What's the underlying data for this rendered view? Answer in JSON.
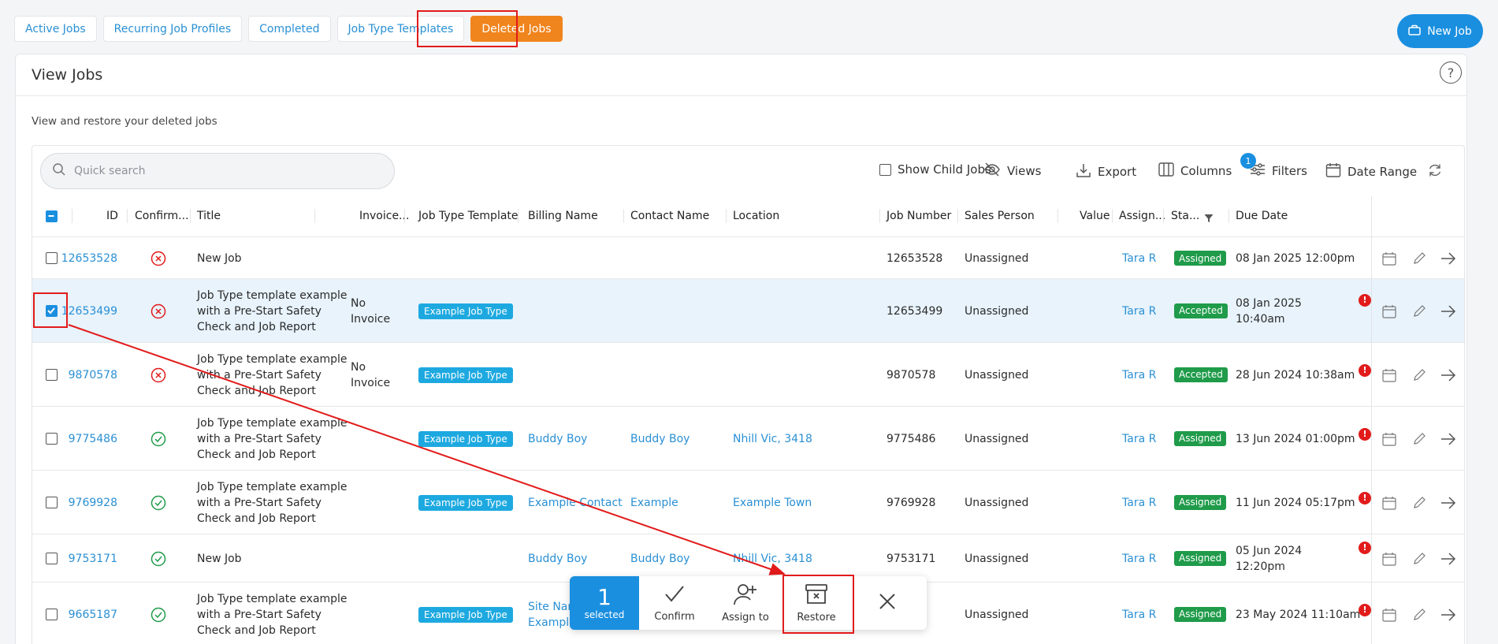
{
  "tabs": [
    {
      "label": "Active Jobs"
    },
    {
      "label": "Recurring Job Profiles"
    },
    {
      "label": "Completed"
    },
    {
      "label": "Job Type Templates"
    },
    {
      "label": "Deleted Jobs",
      "active": true
    }
  ],
  "new_job_label": "New Job",
  "page_title": "View Jobs",
  "help": "?",
  "subtitle": "View and restore your deleted jobs",
  "search": {
    "placeholder": "Quick search"
  },
  "toolbar": {
    "show_child_jobs": "Show Child Jobs",
    "views": "Views",
    "export": "Export",
    "columns": "Columns",
    "filters": "Filters",
    "filters_count": "1",
    "date_range": "Date Range"
  },
  "columns": [
    "ID",
    "Confirm...",
    "Title",
    "Invoice...",
    "Job Type Template",
    "Billing Name",
    "Contact Name",
    "Location",
    "Job Number",
    "Sales Person",
    "Value",
    "Assign...",
    "Sta...",
    "Due Date"
  ],
  "rows": [
    {
      "id": "12653528",
      "confirmed": false,
      "title": [
        "New Job"
      ],
      "invoice": [],
      "job_type": "",
      "billing": [],
      "contact": "",
      "location": "",
      "job_number": "12653528",
      "sales": "Unassigned",
      "value": "",
      "assigned": "Tara R",
      "status": "Assigned",
      "due": [
        "08 Jan 2025 12:00pm"
      ],
      "warn": false,
      "selected": false
    },
    {
      "id": "12653499",
      "confirmed": false,
      "title": [
        "Job Type template example",
        "with a Pre-Start Safety",
        "Check and Job Report"
      ],
      "invoice": [
        "No",
        "Invoice"
      ],
      "job_type": "Example Job Type",
      "billing": [],
      "contact": "",
      "location": "",
      "job_number": "12653499",
      "sales": "Unassigned",
      "value": "",
      "assigned": "Tara R",
      "status": "Accepted",
      "due": [
        "08 Jan 2025",
        "10:40am"
      ],
      "warn": true,
      "selected": true
    },
    {
      "id": "9870578",
      "confirmed": false,
      "title": [
        "Job Type template example",
        "with a Pre-Start Safety",
        "Check and Job Report"
      ],
      "invoice": [
        "No",
        "Invoice"
      ],
      "job_type": "Example Job Type",
      "billing": [],
      "contact": "",
      "location": "",
      "job_number": "9870578",
      "sales": "Unassigned",
      "value": "",
      "assigned": "Tara R",
      "status": "Accepted",
      "due": [
        "28 Jun 2024 10:38am"
      ],
      "warn": true,
      "selected": false
    },
    {
      "id": "9775486",
      "confirmed": true,
      "title": [
        "Job Type template example",
        "with a Pre-Start Safety",
        "Check and Job Report"
      ],
      "invoice": [],
      "job_type": "Example Job Type",
      "billing": [
        "Buddy Boy"
      ],
      "contact": "Buddy Boy",
      "location": "Nhill Vic, 3418",
      "job_number": "9775486",
      "sales": "Unassigned",
      "value": "",
      "assigned": "Tara R",
      "status": "Assigned",
      "due": [
        "13 Jun 2024 01:00pm"
      ],
      "warn": true,
      "selected": false
    },
    {
      "id": "9769928",
      "confirmed": true,
      "title": [
        "Job Type template example",
        "with a Pre-Start Safety",
        "Check and Job Report"
      ],
      "invoice": [],
      "job_type": "Example Job Type",
      "billing": [
        "Example Contact"
      ],
      "contact": "Example",
      "location": "Example Town",
      "job_number": "9769928",
      "sales": "Unassigned",
      "value": "",
      "assigned": "Tara R",
      "status": "Assigned",
      "due": [
        "11 Jun 2024 05:17pm"
      ],
      "warn": true,
      "selected": false
    },
    {
      "id": "9753171",
      "confirmed": true,
      "title": [
        "New Job"
      ],
      "invoice": [],
      "job_type": "",
      "billing": [
        "Buddy Boy"
      ],
      "contact": "Buddy Boy",
      "location": "Nhill Vic, 3418",
      "job_number": "9753171",
      "sales": "Unassigned",
      "value": "",
      "assigned": "Tara R",
      "status": "Assigned",
      "due": [
        "05 Jun 2024",
        "12:20pm"
      ],
      "warn": true,
      "selected": false
    },
    {
      "id": "9665187",
      "confirmed": true,
      "title": [
        "Job Type template example",
        "with a Pre-Start Safety",
        "Check and Job Report"
      ],
      "invoice": [],
      "job_type": "Example Job Type",
      "billing": [
        "Site Name",
        "Example"
      ],
      "contact": "",
      "location": "",
      "job_number": "",
      "sales": "Unassigned",
      "value": "",
      "assigned": "Tara R",
      "status": "Assigned",
      "due": [
        "23 May 2024 11:10am"
      ],
      "warn": true,
      "selected": false
    }
  ],
  "bulk": {
    "count": "1",
    "count_label": "selected",
    "confirm": "Confirm",
    "assign": "Assign to",
    "restore": "Restore"
  },
  "colors": {
    "accent": "#1a8fe0",
    "orange": "#f0841d",
    "green": "#1f9b4a",
    "red": "#e21b1b",
    "link": "#2a90d4"
  }
}
